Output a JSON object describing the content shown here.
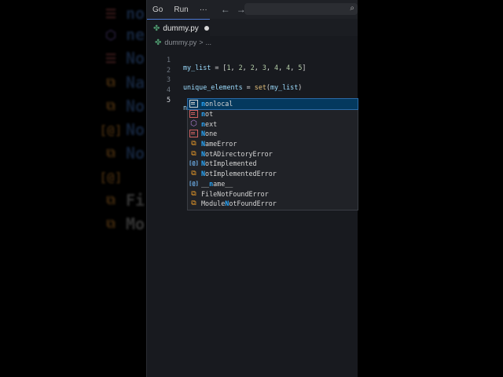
{
  "background_echo": {
    "rows": [
      {
        "icon": "keyword-icon",
        "text": "no"
      },
      {
        "icon": "method-icon",
        "text": "ne"
      },
      {
        "icon": "keyword-icon",
        "text": "No"
      },
      {
        "icon": "class-icon",
        "text": "Na"
      },
      {
        "icon": "class-icon",
        "text": "No"
      },
      {
        "icon": "variable-icon",
        "text": "No"
      },
      {
        "icon": "class-icon",
        "text": "No"
      },
      {
        "icon": "variable-icon",
        "text": ""
      },
      {
        "icon": "class-icon",
        "text": "Fi"
      },
      {
        "icon": "class-icon",
        "text": "Mo"
      }
    ]
  },
  "menubar": {
    "items": [
      "Go",
      "Run",
      "···"
    ],
    "back": "←",
    "forward": "→",
    "search_icon": "search-icon"
  },
  "tab": {
    "filename": "dummy.py",
    "modified": true
  },
  "breadcrumb": {
    "file": "dummy.py",
    "separator": ">",
    "more": "..."
  },
  "editor": {
    "lines": [
      {
        "number": "1",
        "text": "my_list = [1, 2, 2, 3, 4, 4, 5]"
      },
      {
        "number": "2",
        "text": ""
      },
      {
        "number": "3",
        "text": "unique_elements = set(my_list)"
      },
      {
        "number": "4",
        "text": ""
      },
      {
        "number": "5",
        "text": "n"
      }
    ],
    "active_line": "5"
  },
  "suggestions": {
    "typed": "n",
    "items": [
      {
        "kind": "keyword",
        "pre": "",
        "match": "n",
        "post": "onlocal",
        "label": "nonlocal",
        "selected": true
      },
      {
        "kind": "keyword-alt",
        "pre": "",
        "match": "n",
        "post": "ot",
        "label": "not"
      },
      {
        "kind": "function",
        "pre": "",
        "match": "n",
        "post": "ext",
        "label": "next"
      },
      {
        "kind": "keyword-alt",
        "pre": "",
        "match": "N",
        "post": "one",
        "label": "None"
      },
      {
        "kind": "class",
        "pre": "",
        "match": "N",
        "post": "ameError",
        "label": "NameError"
      },
      {
        "kind": "class",
        "pre": "",
        "match": "N",
        "post": "otADirectoryError",
        "label": "NotADirectoryError"
      },
      {
        "kind": "variable",
        "pre": "",
        "match": "N",
        "post": "otImplemented",
        "label": "NotImplemented"
      },
      {
        "kind": "class",
        "pre": "",
        "match": "N",
        "post": "otImplementedError",
        "label": "NotImplementedError"
      },
      {
        "kind": "variable",
        "pre": "__",
        "match": "n",
        "post": "ame__",
        "label": "__name__"
      },
      {
        "kind": "class",
        "pre": "FileNot",
        "match": "",
        "post": "FoundError",
        "label": "FileNotFoundError"
      },
      {
        "kind": "class",
        "pre": "Module",
        "match": "N",
        "post": "otFoundError",
        "label": "ModuleNotFoundError"
      }
    ]
  }
}
